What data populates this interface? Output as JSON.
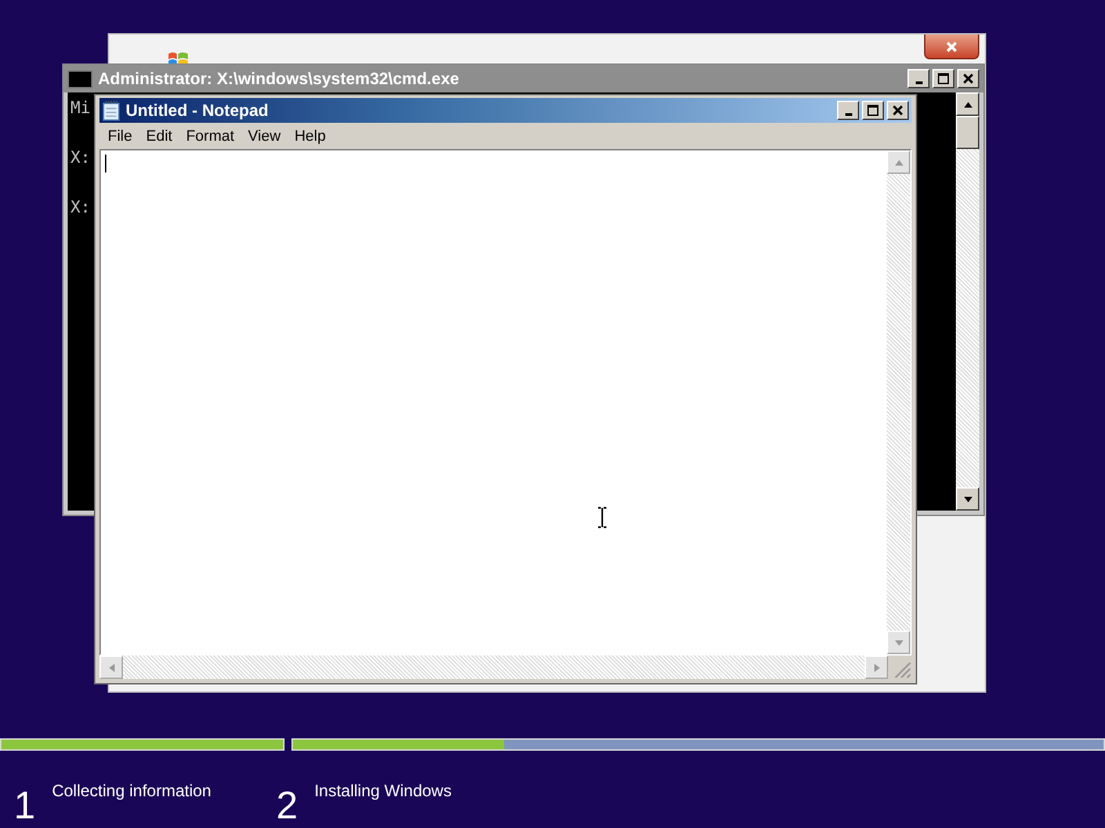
{
  "console_window": {
    "title": "Administrator: X:\\windows\\system32\\cmd.exe",
    "lines": [
      "Mi",
      "X:",
      "X:"
    ]
  },
  "notepad": {
    "title": "Untitled - Notepad",
    "menu": [
      "File",
      "Edit",
      "Format",
      "View",
      "Help"
    ]
  },
  "steps": [
    {
      "number": "1",
      "label": "Collecting information",
      "level": 1
    },
    {
      "number": "2",
      "label": "Installing Windows",
      "level": 0.26
    }
  ]
}
